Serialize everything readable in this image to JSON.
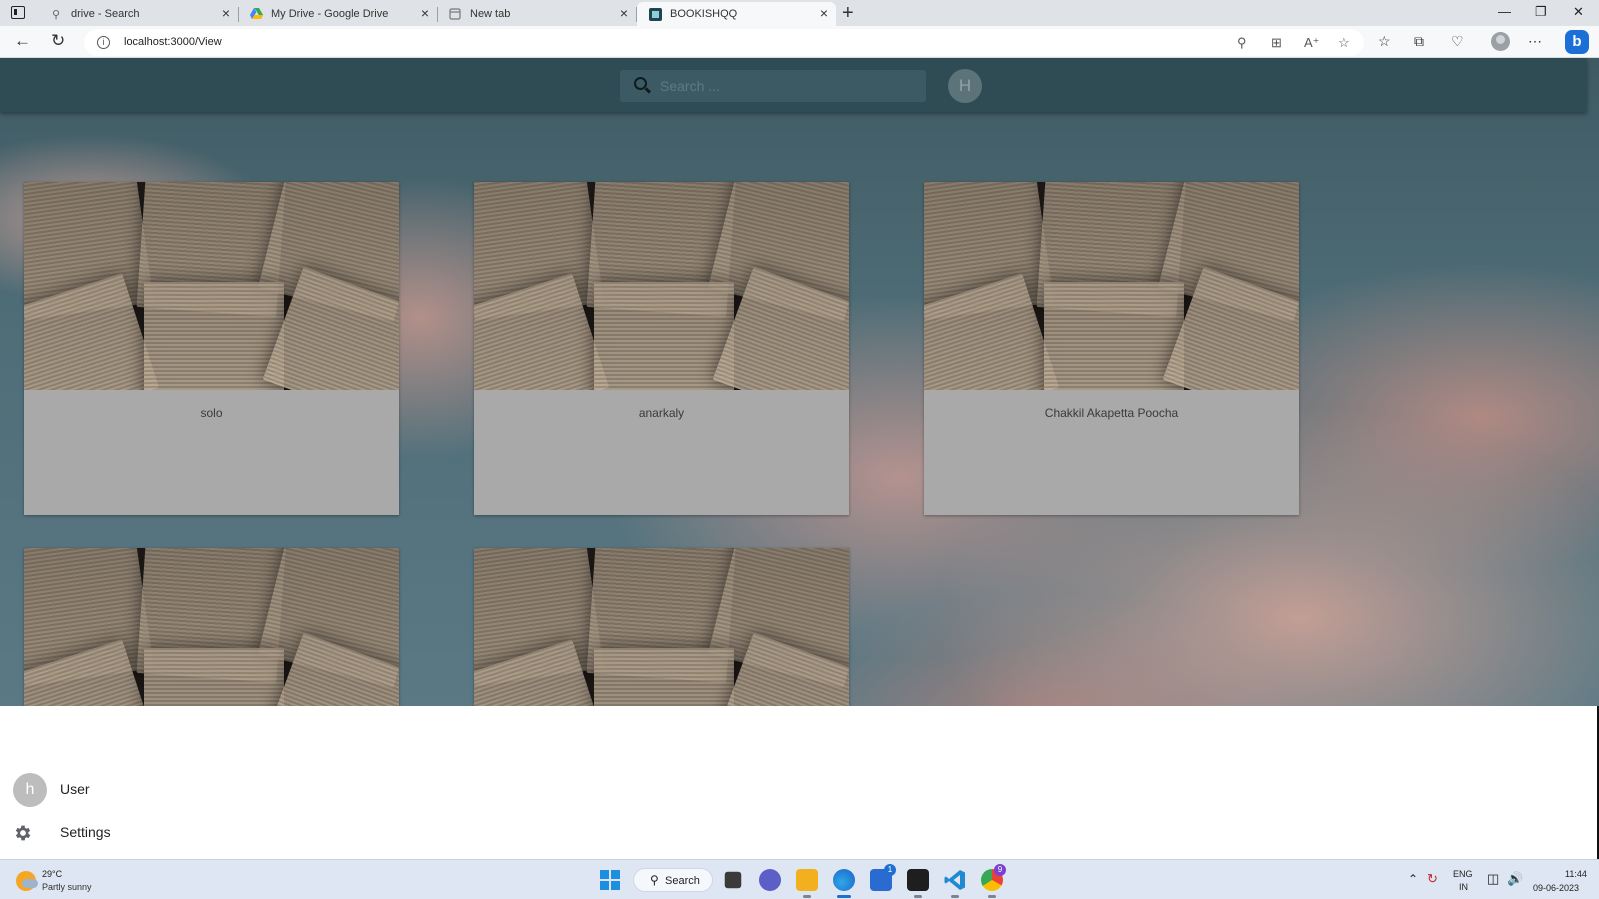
{
  "browser": {
    "tabs": [
      {
        "title": "drive - Search",
        "icon": "search-icon"
      },
      {
        "title": "My Drive - Google Drive",
        "icon": "google-drive-icon"
      },
      {
        "title": "New tab",
        "icon": "page-icon"
      },
      {
        "title": "BOOKISHQQ",
        "icon": "site-icon",
        "active": true
      }
    ],
    "url": "localhost:3000/View"
  },
  "app": {
    "search_placeholder": "Search ...",
    "avatar_letter": "H",
    "books": [
      {
        "title": "solo"
      },
      {
        "title": "anarkaly"
      },
      {
        "title": "Chakkil Akapetta Poocha"
      },
      {
        "title": ""
      },
      {
        "title": ""
      }
    ],
    "menu": {
      "user_avatar_letter": "h",
      "user_label": "User",
      "settings_label": "Settings"
    }
  },
  "taskbar": {
    "temperature": "29°C",
    "weather": "Partly sunny",
    "search_label": "Search",
    "language": "ENG",
    "region": "IN",
    "time": "11:44",
    "date": "09-06-2023",
    "store_badge": "1",
    "chrome_badge": "9"
  }
}
